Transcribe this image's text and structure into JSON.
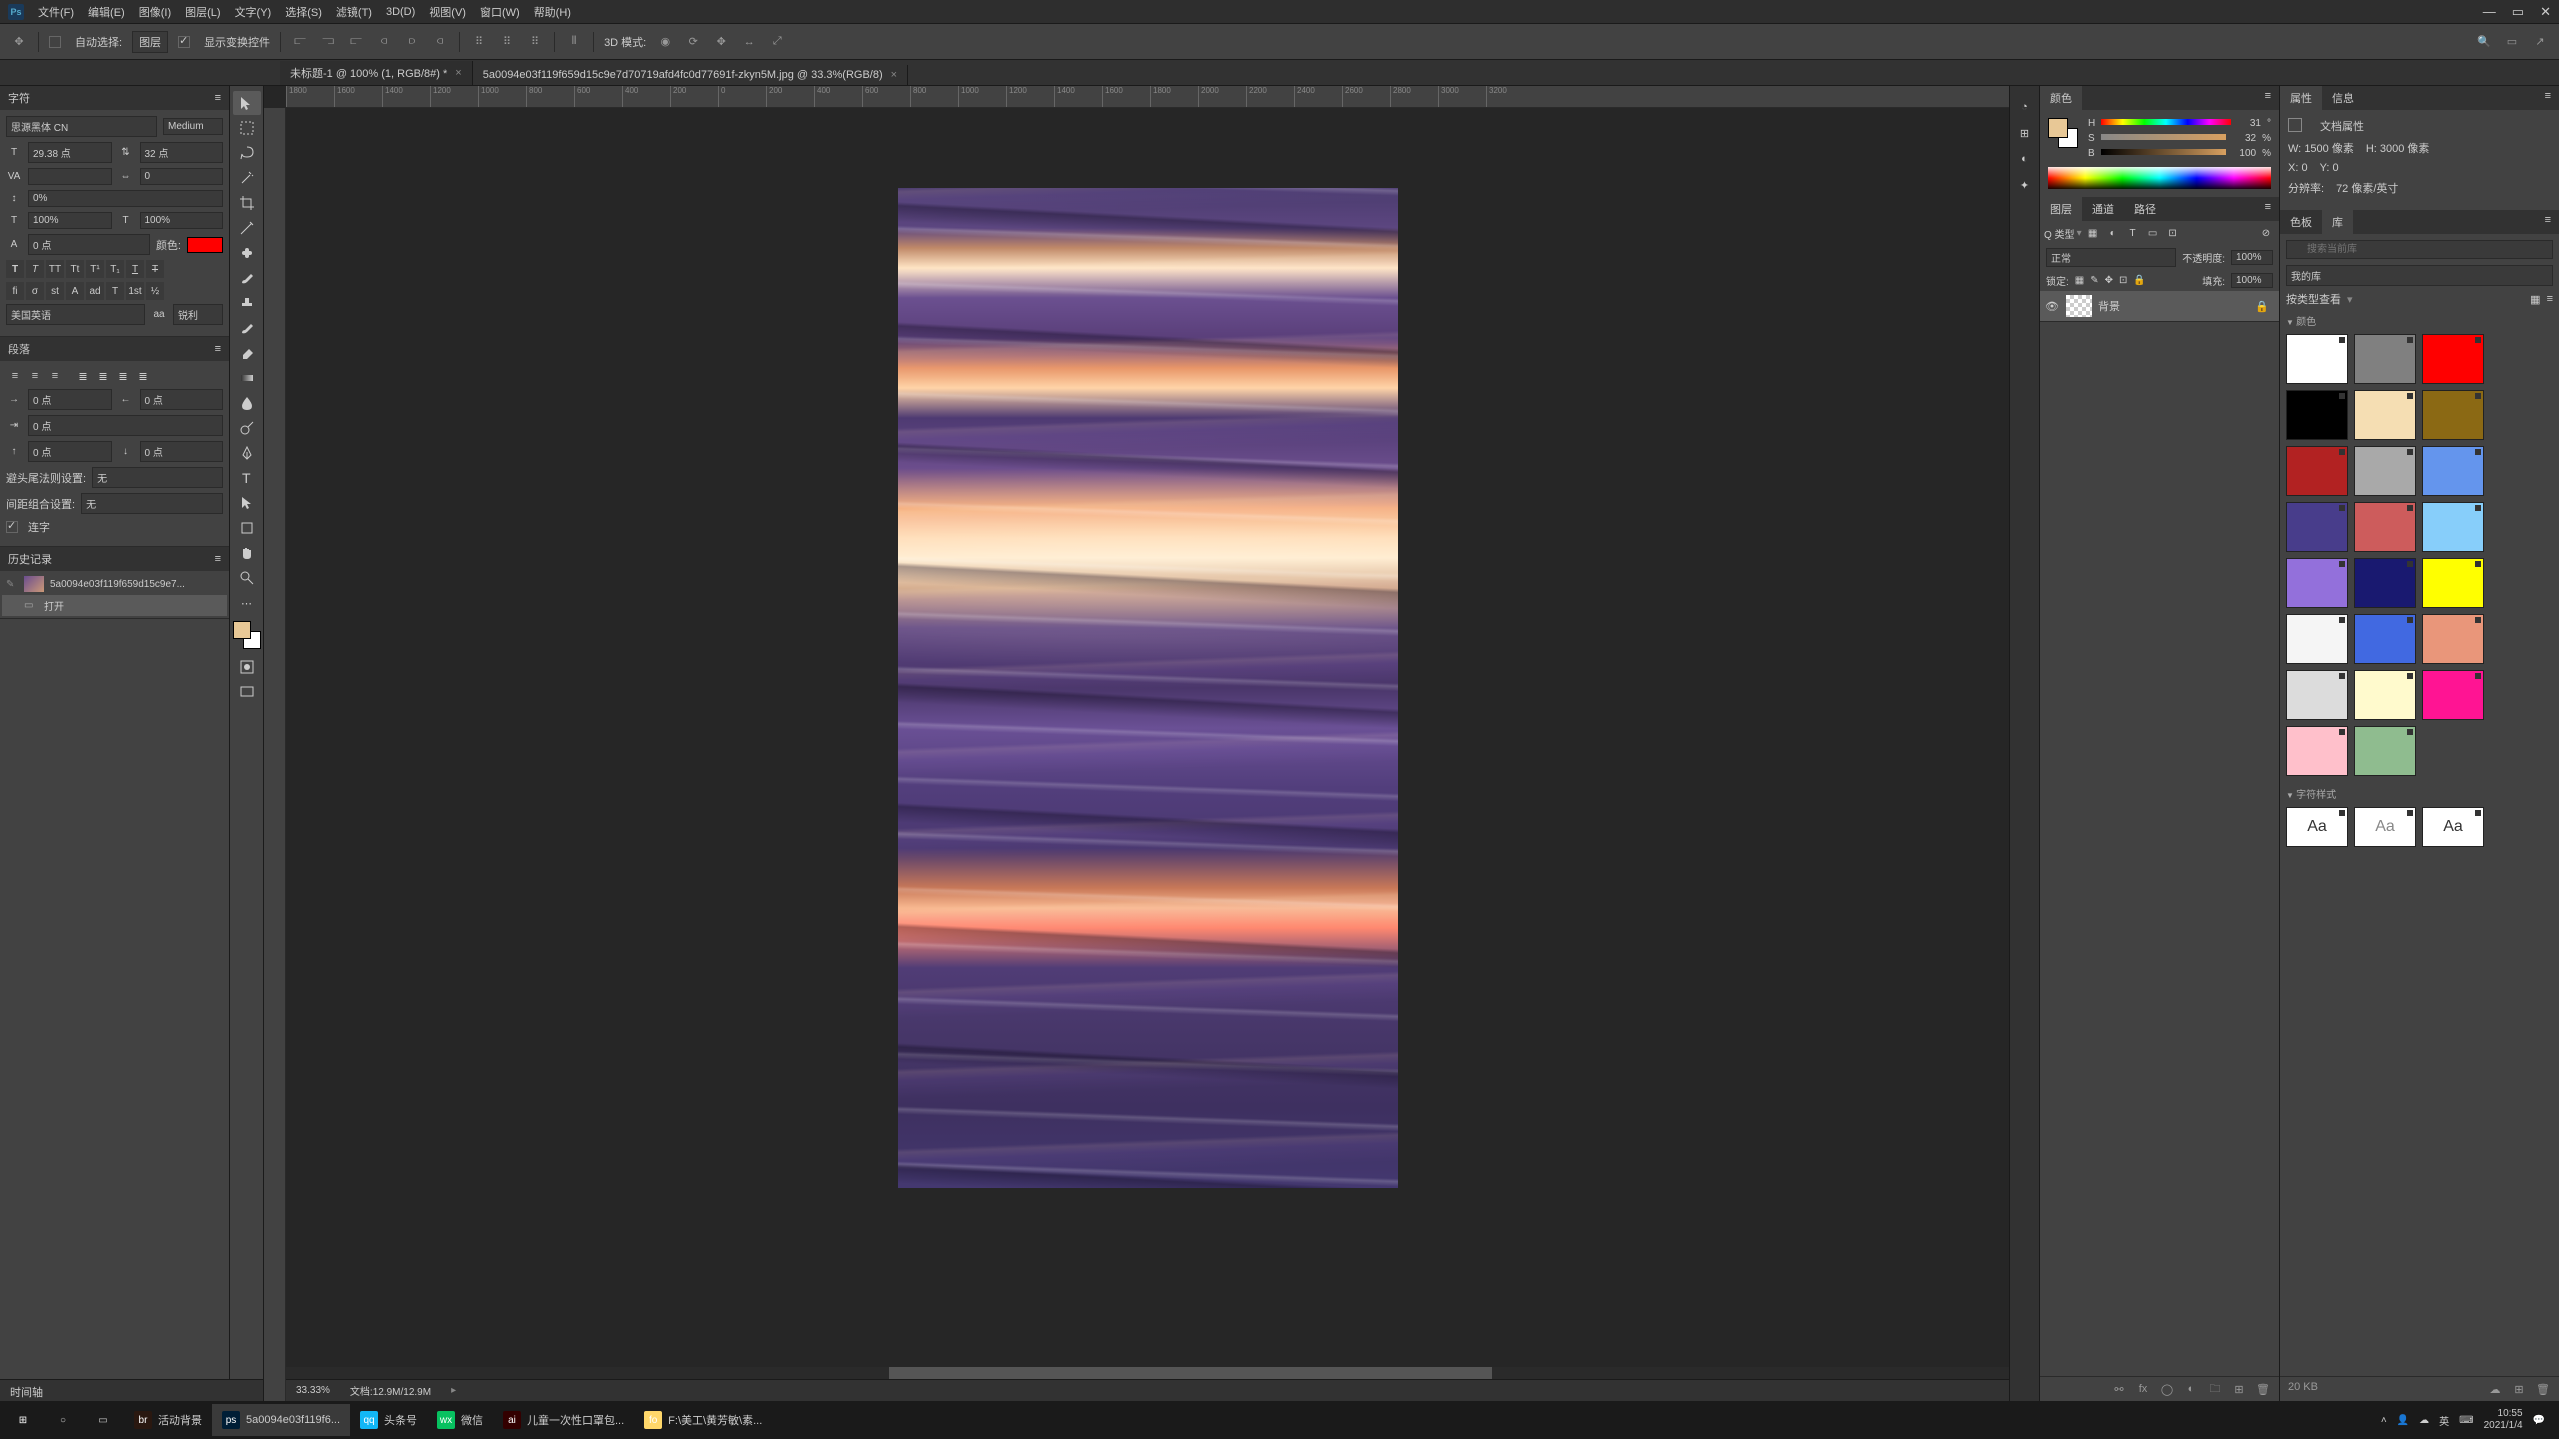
{
  "menu": {
    "items": [
      "文件(F)",
      "编辑(E)",
      "图像(I)",
      "图层(L)",
      "文字(Y)",
      "选择(S)",
      "滤镜(T)",
      "3D(D)",
      "视图(V)",
      "窗口(W)",
      "帮助(H)"
    ]
  },
  "options": {
    "auto_select": "自动选择:",
    "layer": "图层",
    "show_controls": "显示变换控件",
    "mode_3d": "3D 模式:"
  },
  "tabs": [
    {
      "label": "未标题-1 @ 100% (1, RGB/8#) *",
      "active": false
    },
    {
      "label": "5a0094e03f119f659d15c9e7d70719afd4fc0d77691f-zkyn5M.jpg @ 33.3%(RGB/8)",
      "active": true
    }
  ],
  "ruler_marks": [
    "1800",
    "1600",
    "1400",
    "1200",
    "1000",
    "800",
    "600",
    "400",
    "200",
    "0",
    "200",
    "400",
    "600",
    "800",
    "1000",
    "1200",
    "1400",
    "1600",
    "1800",
    "2000",
    "2200",
    "2400",
    "2600",
    "2800",
    "3000",
    "3200"
  ],
  "char_panel": {
    "title": "字符",
    "font_family": "思源黑体 CN",
    "font_style": "Medium",
    "size": "29.38 点",
    "leading": "32 点",
    "tracking": "0",
    "kerning": "VA",
    "baseline": "0%",
    "vscale": "100%",
    "hscale": "100%",
    "baseline_shift": "0 点",
    "color_label": "颜色:",
    "language": "美国英语",
    "aa": "锐利"
  },
  "para_panel": {
    "title": "段落",
    "indent_left": "0 点",
    "indent_right": "0 点",
    "indent_first": "0 点",
    "space_before": "0 点",
    "space_after": "0 点",
    "hyphen_label": "避头尾法则设置:",
    "hyphen_val": "无",
    "spacing_label": "间距组合设置:",
    "spacing_val": "无",
    "hyphenate": "连字"
  },
  "history_panel": {
    "title": "历史记录",
    "doc_name": "5a0094e03f119f659d15c9e7...",
    "open": "打开"
  },
  "color_panel": {
    "title": "颜色",
    "h_label": "H",
    "s_label": "S",
    "b_label": "B",
    "h_val": "31",
    "s_val": "32",
    "b_val": "100"
  },
  "layers_panel": {
    "tabs": [
      "图层",
      "通道",
      "路径"
    ],
    "kind": "Q 类型",
    "blend": "正常",
    "opacity_label": "不透明度:",
    "opacity_val": "100%",
    "lock_label": "锁定:",
    "fill_label": "填充:",
    "fill_val": "100%",
    "layer_name": "背景"
  },
  "props_panel": {
    "tabs": [
      "属性",
      "信息"
    ],
    "doc_props": "文档属性",
    "w_label": "W:",
    "w_val": "1500 像素",
    "h_label": "H:",
    "h_val": "3000 像素",
    "x_label": "X:",
    "x_val": "0",
    "y_label": "Y:",
    "y_val": "0",
    "res_label": "分辨率:",
    "res_val": "72 像素/英寸"
  },
  "swatches_panel": {
    "tabs": [
      "色板",
      "库"
    ],
    "search_placeholder": "搜索当前库",
    "my_lib": "我的库",
    "view_label": "按类型查看",
    "colors_label": "颜色",
    "styles_label": "字符样式",
    "colors": [
      "#ffffff",
      "#808080",
      "#ff0000",
      "#000000",
      "#f5deb3",
      "#8b6914",
      "#b22222",
      "#a9a9a9",
      "#6495ed",
      "#483d8b",
      "#cd5c5c",
      "#87cefa",
      "#9370db",
      "#191970",
      "#ffff00",
      "#f5f5f5",
      "#4169e1",
      "#e9967a",
      "#dcdcdc",
      "#fffacd",
      "#ff1493",
      "#ffc0cb",
      "#8fbc8f"
    ],
    "aa_label": "Aa"
  },
  "status": {
    "zoom": "33.33%",
    "doc_size": "文档:12.9M/12.9M",
    "timeline": "时间轴",
    "file_size": "20 KB"
  },
  "taskbar": {
    "items": [
      {
        "icon": "win",
        "label": ""
      },
      {
        "icon": "search",
        "label": ""
      },
      {
        "icon": "task",
        "label": ""
      },
      {
        "icon": "br",
        "label": "活动背景",
        "color": "#2a1810"
      },
      {
        "icon": "ps",
        "label": "5a0094e03f119f6...",
        "color": "#001e36",
        "active": true
      },
      {
        "icon": "qq",
        "label": "头条号",
        "color": "#12b7f5"
      },
      {
        "icon": "wx",
        "label": "微信",
        "color": "#07c160"
      },
      {
        "icon": "ai",
        "label": "儿童一次性口罩包...",
        "color": "#330000"
      },
      {
        "icon": "folder",
        "label": "F:\\美工\\黄芳敏\\素...",
        "color": "#ffd76a"
      }
    ],
    "time": "10:55",
    "date": "2021/1/4"
  }
}
